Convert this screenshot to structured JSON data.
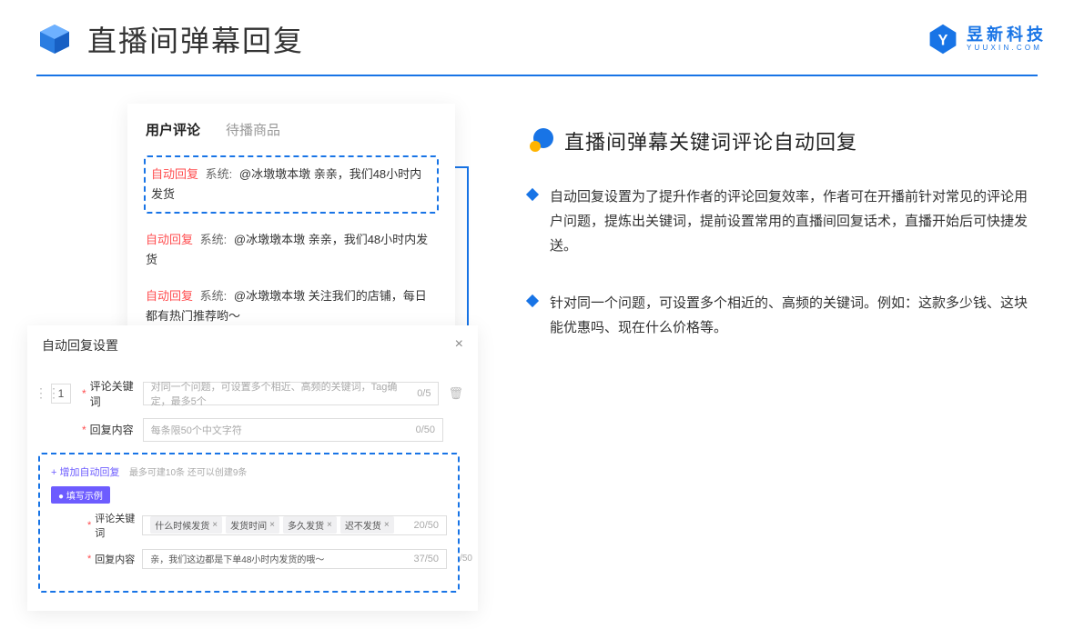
{
  "header": {
    "title": "直播间弹幕回复"
  },
  "brand": {
    "cn": "昱新科技",
    "en": "YUUXIN.COM"
  },
  "comments": {
    "tab_active": "用户评论",
    "tab_inactive": "待播商品",
    "row1_badge": "自动回复",
    "row1_sys": "系统:",
    "row1_text": "@冰墩墩本墩 亲亲，我们48小时内发货",
    "row2_badge": "自动回复",
    "row2_sys": "系统:",
    "row2_text": "@冰墩墩本墩 亲亲，我们48小时内发货",
    "row3_badge": "自动回复",
    "row3_sys": "系统:",
    "row3_text": "@冰墩墩本墩 关注我们的店铺，每日都有热门推荐哟～"
  },
  "settings": {
    "title": "自动回复设置",
    "idx": "1",
    "kw_label": "评论关键词",
    "kw_placeholder": "对同一个问题，可设置多个相近、高频的关键词，Tag确定，最多5个",
    "kw_counter": "0/5",
    "content_label": "回复内容",
    "content_placeholder": "每条限50个中文字符",
    "content_counter": "0/50",
    "add_link": "+ 增加自动回复",
    "add_hint": "最多可建10条 还可以创建9条",
    "ex_badge": "● 填写示例",
    "ex_kw_label": "评论关键词",
    "ex_tags": [
      "什么时候发货",
      "发货时间",
      "多久发货",
      "迟不发货"
    ],
    "ex_kw_counter": "20/50",
    "ex_content_label": "回复内容",
    "ex_content_value": "亲，我们这边都是下单48小时内发货的哦～",
    "ex_content_counter": "37/50",
    "out_counter": "/50"
  },
  "right": {
    "section_title": "直播间弹幕关键词评论自动回复",
    "point1": "自动回复设置为了提升作者的评论回复效率，作者可在开播前针对常见的评论用户问题，提炼出关键词，提前设置常用的直播间回复话术，直播开始后可快捷发送。",
    "point2": "针对同一个问题，可设置多个相近的、高频的关键词。例如：这款多少钱、这块能优惠吗、现在什么价格等。"
  }
}
